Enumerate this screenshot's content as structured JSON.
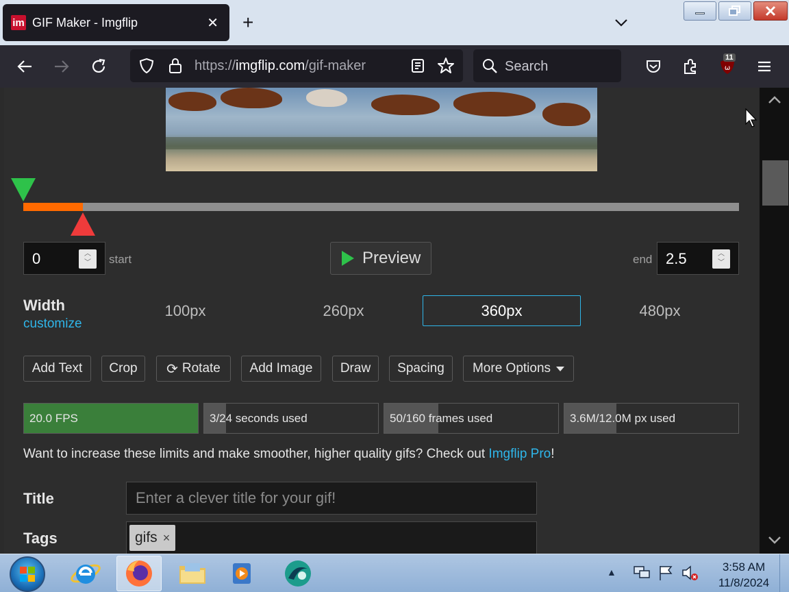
{
  "browser": {
    "tab_title": "GIF Maker - Imgflip",
    "favicon_text": "im",
    "url_scheme": "https://",
    "url_host": "imgflip.com",
    "url_path": "/gif-maker",
    "search_label": "Search",
    "extension_badge": "11"
  },
  "timeline": {
    "start_fraction": 0.0,
    "end_fraction": 0.083
  },
  "trim": {
    "start_value": "0",
    "start_label": "start",
    "end_label": "end",
    "end_value": "2.5",
    "preview_label": "Preview"
  },
  "width": {
    "label": "Width",
    "customize_label": "customize",
    "options": [
      "100px",
      "260px",
      "360px",
      "480px"
    ],
    "selected": "360px"
  },
  "tools": {
    "add_text": "Add Text",
    "crop": "Crop",
    "rotate": "Rotate",
    "add_image": "Add Image",
    "draw": "Draw",
    "spacing": "Spacing",
    "more_options": "More Options"
  },
  "meters": {
    "fps": {
      "label": "20.0 FPS",
      "fraction": 1.0,
      "color": "#3a7f3a"
    },
    "seconds": {
      "label": "3/24 seconds used",
      "fraction": 0.125,
      "color": "#555555"
    },
    "frames": {
      "label": "50/160 frames used",
      "fraction": 0.3125,
      "color": "#555555"
    },
    "pixels": {
      "label": "3.6M/12.0M px used",
      "fraction": 0.3,
      "color": "#555555"
    }
  },
  "limits": {
    "text": "Want to increase these limits and make smoother, higher quality gifs? Check out ",
    "link": "Imgflip Pro",
    "suffix": "!"
  },
  "form": {
    "title_label": "Title",
    "title_placeholder": "Enter a clever title for your gif!",
    "tags_label": "Tags",
    "tags": [
      "gifs"
    ]
  },
  "taskbar": {
    "time": "3:58 AM",
    "date": "11/8/2024"
  },
  "colors": {
    "accent": "#2fb6ea",
    "start_marker": "#2ec24a",
    "end_marker": "#ef3b3b",
    "range_fill": "#ff6a00"
  }
}
